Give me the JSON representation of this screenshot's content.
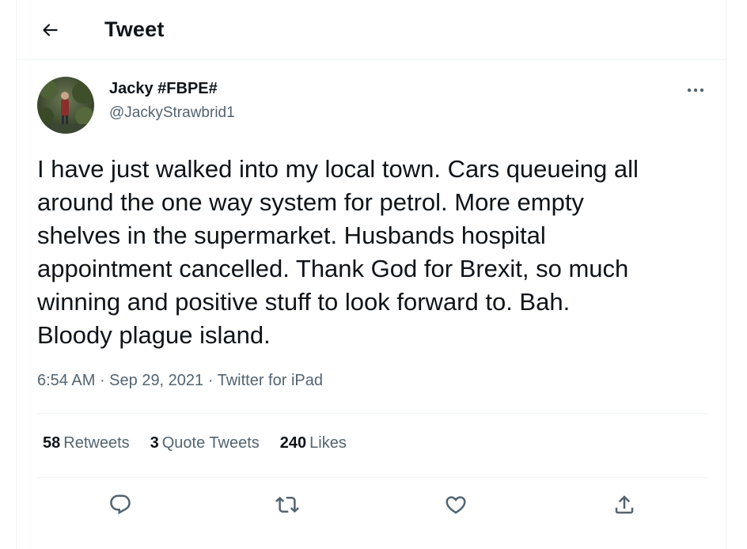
{
  "header": {
    "title": "Tweet",
    "back_icon": "arrow-left-icon"
  },
  "author": {
    "name": "Jacky #FBPE#",
    "handle": "@JackyStrawbrid1"
  },
  "tweet": {
    "text": "I have just walked into my local town. Cars queueing all\naround the one way system for petrol. More empty\nshelves in the supermarket. Husbands hospital\nappointment cancelled. Thank God for Brexit, so much\nwinning and positive stuff to look forward to. Bah.\nBloody plague island.",
    "time": "6:54 AM",
    "separator": " · ",
    "date": "Sep 29, 2021",
    "source": "Twitter for iPad"
  },
  "stats": {
    "retweets_count": "58",
    "retweets_label": "Retweets",
    "quotes_count": "3",
    "quotes_label": "Quote Tweets",
    "likes_count": "240",
    "likes_label": "Likes"
  },
  "actions": [
    "reply-icon",
    "retweet-icon",
    "like-icon",
    "share-icon"
  ],
  "colors": {
    "text_primary": "#0f1419",
    "text_secondary": "#536471",
    "border": "#eff3f4"
  }
}
